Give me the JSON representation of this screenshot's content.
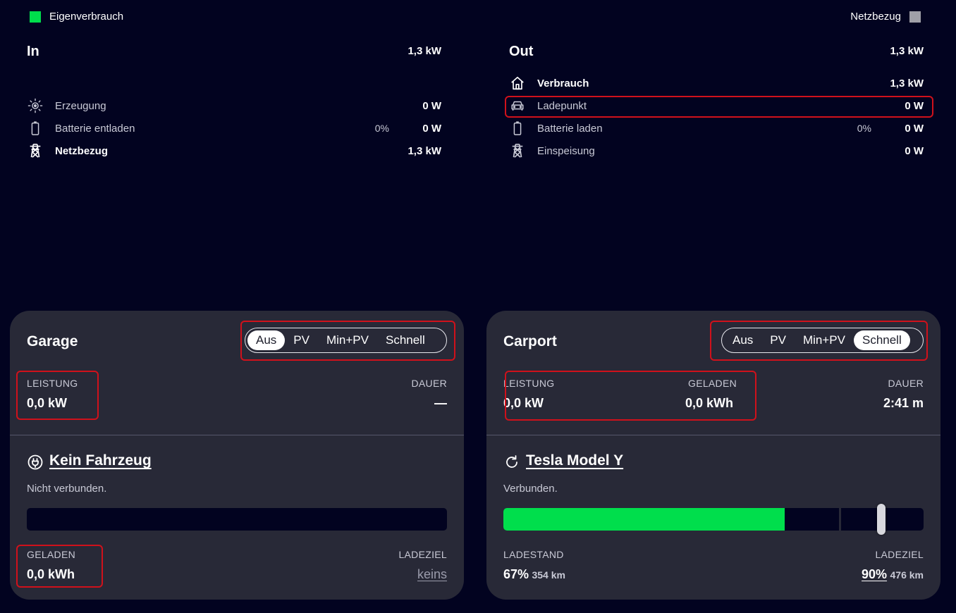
{
  "legend": {
    "self_consumption": {
      "label": "Eigenverbrauch",
      "color": "#00de4c"
    },
    "grid_import": {
      "label": "Netzbezug",
      "color": "#a0a0a8"
    }
  },
  "energy_in": {
    "title": "In",
    "total": "1,3 kW",
    "rows": [
      {
        "icon": "sun-icon",
        "label": "Erzeugung",
        "value": "0 W",
        "bold": false
      },
      {
        "icon": "battery-icon",
        "label": "Batterie entladen",
        "percent": "0%",
        "value": "0 W",
        "bold": false
      },
      {
        "icon": "power-pylon-icon",
        "label": "Netzbezug",
        "value": "1,3 kW",
        "bold": true
      }
    ]
  },
  "energy_out": {
    "title": "Out",
    "total": "1,3 kW",
    "rows": [
      {
        "icon": "house-icon",
        "label": "Verbrauch",
        "value": "1,3 kW",
        "bold": true
      },
      {
        "icon": "car-icon",
        "label": "Ladepunkt",
        "value": "0 W",
        "bold": false
      },
      {
        "icon": "battery-icon",
        "label": "Batterie laden",
        "percent": "0%",
        "value": "0 W",
        "bold": false
      },
      {
        "icon": "power-pylon-icon",
        "label": "Einspeisung",
        "value": "0 W",
        "bold": false
      }
    ]
  },
  "loadpoints": [
    {
      "title": "Garage",
      "modes": [
        "Aus",
        "PV",
        "Min+PV",
        "Schnell"
      ],
      "active_mode": "Aus",
      "power_label": "LEISTUNG",
      "power_value": "0,0 kW",
      "duration_label": "DAUER",
      "duration_value": "—",
      "vehicle_icon": "plug-icon",
      "vehicle_name": "Kein Fahrzeug",
      "status": "Nicht verbunden.",
      "soc": 0,
      "charged_label": "GELADEN",
      "charged_value": "0,0 kWh",
      "target_label": "LADEZIEL",
      "target_value": "keins"
    },
    {
      "title": "Carport",
      "modes": [
        "Aus",
        "PV",
        "Min+PV",
        "Schnell"
      ],
      "active_mode": "Schnell",
      "power_label": "LEISTUNG",
      "power_value": "0,0 kW",
      "charged_label": "GELADEN",
      "charged_value": "0,0 kWh",
      "duration_label": "DAUER",
      "duration_value": "2:41 m",
      "vehicle_icon": "refresh-icon",
      "vehicle_name": "Tesla Model Y",
      "status": "Verbunden.",
      "soc": 0.67,
      "target_soc": 0.9,
      "soc_label": "LADESTAND",
      "soc_value": "67%",
      "soc_range": "354 km",
      "target_label": "LADEZIEL",
      "target_value": "90%",
      "target_range": "476 km"
    }
  ]
}
